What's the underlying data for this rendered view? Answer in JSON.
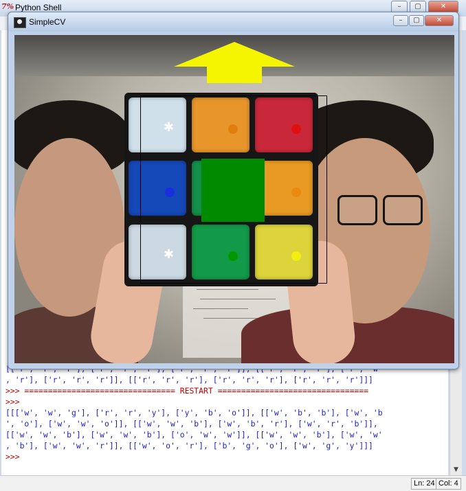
{
  "shell": {
    "title": "Python Shell",
    "lines": [
      {
        "text": "[['r', 'r', 'r'], ['r', 'r', 'r'], ['r', 'r', 'r']], [['r', 'r', 'r'], ['r', 'w'",
        "color": "blue"
      },
      {
        "text": ", 'r'], ['r', 'r', 'r']], [['r', 'r', 'r'], ['r', 'r', 'r'], ['r', 'r', 'r']]]",
        "color": "blue"
      },
      {
        "text": ">>> ================================ RESTART ================================",
        "color": "mixed"
      },
      {
        "text": ">>> ",
        "color": "red"
      },
      {
        "text": "[[['w', 'w', 'g'], ['r', 'r', 'y'], ['y', 'b', 'o']], [['w', 'b', 'b'], ['w', 'b",
        "color": "blue"
      },
      {
        "text": "', 'o'], ['w', 'w', 'o']], [['w', 'w', 'b'], ['w', 'b', 'r'], ['w', 'r', 'b']],",
        "color": "blue"
      },
      {
        "text": "[['w', 'w', 'b'], ['w', 'w', 'b'], ['o', 'w', 'w']], [['w', 'w', 'b'], ['w', 'w'",
        "color": "blue"
      },
      {
        "text": ", 'b'], ['w', 'w', 'r']], [['w', 'o', 'r'], ['b', 'g', 'o'], ['w', 'g', 'y']]]",
        "color": "blue"
      },
      {
        "text": ">>> ",
        "color": "red"
      }
    ],
    "status": {
      "line": "Ln: 24",
      "col": "Col: 4"
    }
  },
  "simplecv": {
    "title": "SimpleCV",
    "cube_stickers": [
      {
        "color": "#cfe0ea",
        "marker": "#ffffff"
      },
      {
        "color": "#e8962a",
        "marker": "#e07f10"
      },
      {
        "color": "#c8283a",
        "marker": "#e01010"
      },
      {
        "color": "#1548b8",
        "marker": "#1a2ee0"
      },
      {
        "color": "#12904a",
        "marker": "#008a00"
      },
      {
        "color": "#e89a22",
        "marker": "#e88a10"
      },
      {
        "color": "#cbd8e2",
        "marker": "#ffffff"
      },
      {
        "color": "#129a48",
        "marker": "#009a00"
      },
      {
        "color": "#dcd43a",
        "marker": "#f2ee10"
      }
    ],
    "arrow_color": "#f5f500",
    "highlight_color": "#008a00"
  }
}
